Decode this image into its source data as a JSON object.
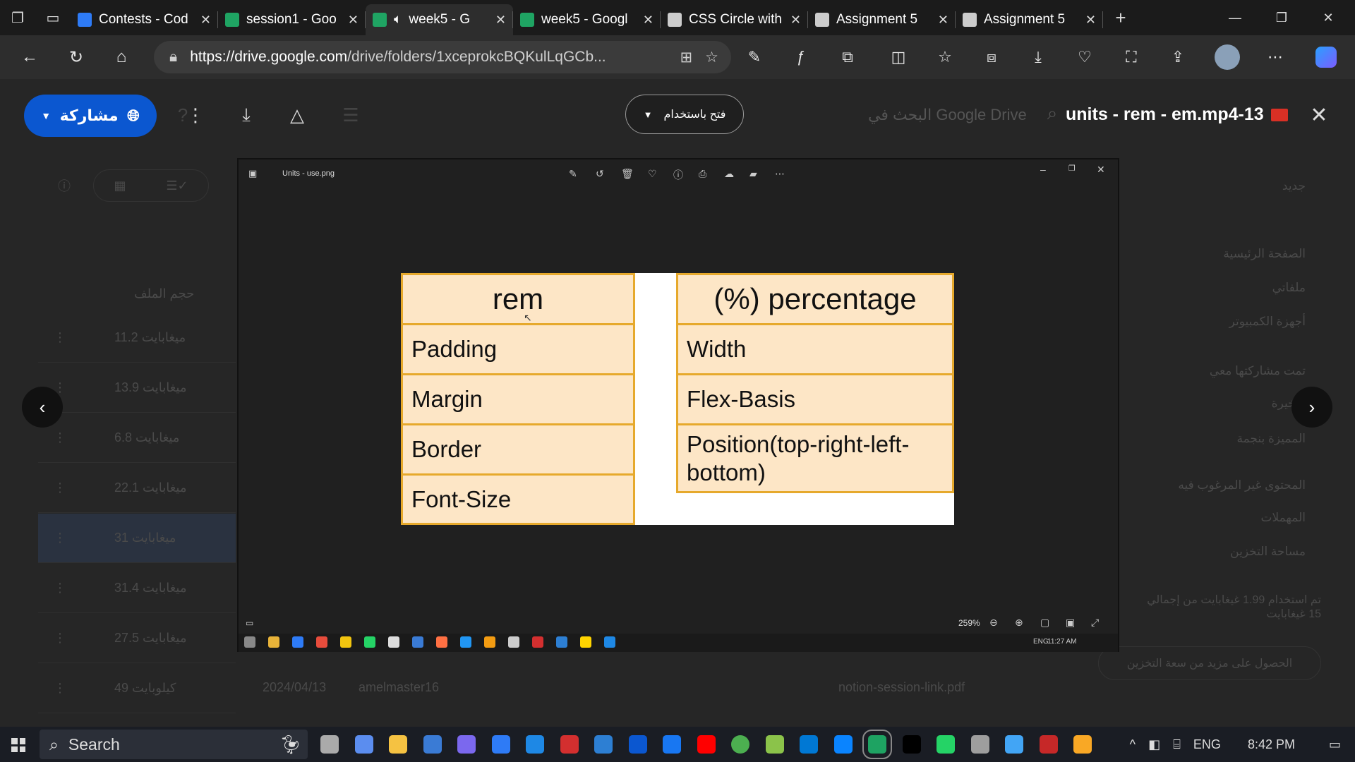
{
  "browser": {
    "tabs": [
      {
        "title": "Contests - Cod",
        "favicon_color": "#2e7bf6"
      },
      {
        "title": "session1 - Goo",
        "favicon_color": "#1fa463"
      },
      {
        "title": "week5 - G",
        "favicon_color": "#1fa463",
        "active": true
      },
      {
        "title": "week5 - Googl",
        "favicon_color": "#1fa463"
      },
      {
        "title": "CSS Circle with",
        "favicon_color": "#cccccc"
      },
      {
        "title": "Assignment 5",
        "favicon_color": "#cccccc"
      },
      {
        "title": "Assignment 5",
        "favicon_color": "#cccccc"
      }
    ],
    "url_host": "https://drive.google.com",
    "url_path": "/drive/folders/1xceprokcBQKulLqGCb..."
  },
  "drive": {
    "share_label": "مشاركة",
    "open_with_label": "فتح باستخدام",
    "file_title": "units - rem - em.mp4-13",
    "search_placeholder": "البحث في Google Drive",
    "list_header_size": "حجم الملف",
    "sizes": [
      "11.2 ميغابايت",
      "13.9 ميغابايت",
      "6.8 ميغابايت",
      "22.1 ميغابايت",
      "31 ميغابايت",
      "31.4 ميغابايت",
      "27.5 ميغابايت",
      "49 كيلوبايت"
    ],
    "bottom_date": "2024/04/13",
    "bottom_owner": "amelmaster16",
    "bottom_file": "notion-session-link.pdf",
    "sidebar": [
      "جديد",
      "الصفحة الرئيسية",
      "ملفاتي",
      "أجهزة الكمبيوتر",
      "تمت مشاركتها معي",
      "الأخيرة",
      "المميزة بنجمة",
      "المحتوى غير المرغوب فيه",
      "المهملات",
      "مساحة التخزين"
    ],
    "storage_text": "تم استخدام 1.99 غيغابايت من إجمالي 15 غيغابايت",
    "storage_button": "الحصول على مزيد من سعة التخزين"
  },
  "photos": {
    "title": "Units - use.png",
    "zoom": "259%",
    "slide": {
      "left_col": [
        "rem",
        "Padding",
        "Margin",
        "Border",
        "Font-Size"
      ],
      "right_col": [
        "(%) percentage",
        "Width",
        "Flex-Basis",
        "Position(top-right-left-bottom)"
      ]
    },
    "inner_clock": "11:27 AM",
    "inner_lang": "ENG"
  },
  "taskbar": {
    "search_label": "Search",
    "lang": "ENG",
    "clock": "8:42 PM"
  },
  "colors": {
    "accent": "#0b57d0",
    "cell_fill": "#fde6c6",
    "cell_border": "#e6a92c"
  }
}
